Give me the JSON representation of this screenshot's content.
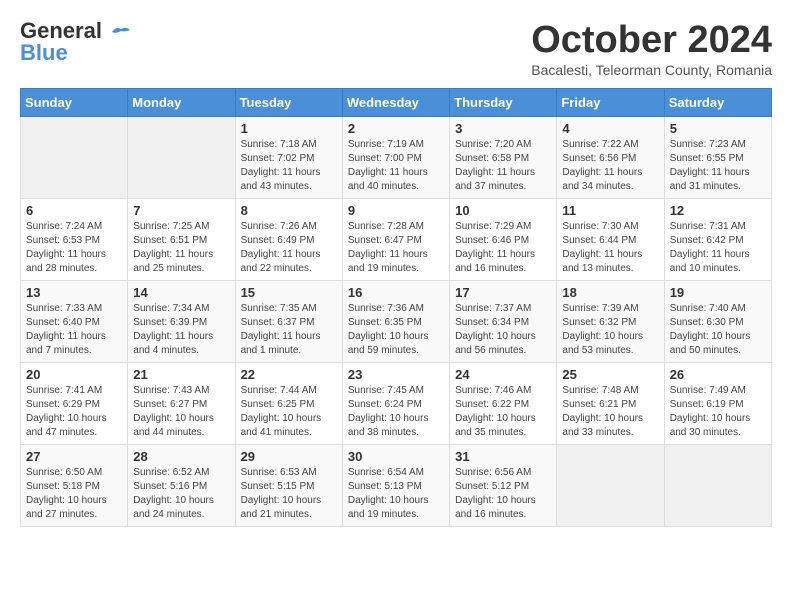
{
  "header": {
    "logo_line1": "General",
    "logo_line2": "Blue",
    "month_title": "October 2024",
    "location": "Bacalesti, Teleorman County, Romania"
  },
  "days_of_week": [
    "Sunday",
    "Monday",
    "Tuesday",
    "Wednesday",
    "Thursday",
    "Friday",
    "Saturday"
  ],
  "weeks": [
    [
      {
        "day": "",
        "info": ""
      },
      {
        "day": "",
        "info": ""
      },
      {
        "day": "1",
        "info": "Sunrise: 7:18 AM\nSunset: 7:02 PM\nDaylight: 11 hours and 43 minutes."
      },
      {
        "day": "2",
        "info": "Sunrise: 7:19 AM\nSunset: 7:00 PM\nDaylight: 11 hours and 40 minutes."
      },
      {
        "day": "3",
        "info": "Sunrise: 7:20 AM\nSunset: 6:58 PM\nDaylight: 11 hours and 37 minutes."
      },
      {
        "day": "4",
        "info": "Sunrise: 7:22 AM\nSunset: 6:56 PM\nDaylight: 11 hours and 34 minutes."
      },
      {
        "day": "5",
        "info": "Sunrise: 7:23 AM\nSunset: 6:55 PM\nDaylight: 11 hours and 31 minutes."
      }
    ],
    [
      {
        "day": "6",
        "info": "Sunrise: 7:24 AM\nSunset: 6:53 PM\nDaylight: 11 hours and 28 minutes."
      },
      {
        "day": "7",
        "info": "Sunrise: 7:25 AM\nSunset: 6:51 PM\nDaylight: 11 hours and 25 minutes."
      },
      {
        "day": "8",
        "info": "Sunrise: 7:26 AM\nSunset: 6:49 PM\nDaylight: 11 hours and 22 minutes."
      },
      {
        "day": "9",
        "info": "Sunrise: 7:28 AM\nSunset: 6:47 PM\nDaylight: 11 hours and 19 minutes."
      },
      {
        "day": "10",
        "info": "Sunrise: 7:29 AM\nSunset: 6:46 PM\nDaylight: 11 hours and 16 minutes."
      },
      {
        "day": "11",
        "info": "Sunrise: 7:30 AM\nSunset: 6:44 PM\nDaylight: 11 hours and 13 minutes."
      },
      {
        "day": "12",
        "info": "Sunrise: 7:31 AM\nSunset: 6:42 PM\nDaylight: 11 hours and 10 minutes."
      }
    ],
    [
      {
        "day": "13",
        "info": "Sunrise: 7:33 AM\nSunset: 6:40 PM\nDaylight: 11 hours and 7 minutes."
      },
      {
        "day": "14",
        "info": "Sunrise: 7:34 AM\nSunset: 6:39 PM\nDaylight: 11 hours and 4 minutes."
      },
      {
        "day": "15",
        "info": "Sunrise: 7:35 AM\nSunset: 6:37 PM\nDaylight: 11 hours and 1 minute."
      },
      {
        "day": "16",
        "info": "Sunrise: 7:36 AM\nSunset: 6:35 PM\nDaylight: 10 hours and 59 minutes."
      },
      {
        "day": "17",
        "info": "Sunrise: 7:37 AM\nSunset: 6:34 PM\nDaylight: 10 hours and 56 minutes."
      },
      {
        "day": "18",
        "info": "Sunrise: 7:39 AM\nSunset: 6:32 PM\nDaylight: 10 hours and 53 minutes."
      },
      {
        "day": "19",
        "info": "Sunrise: 7:40 AM\nSunset: 6:30 PM\nDaylight: 10 hours and 50 minutes."
      }
    ],
    [
      {
        "day": "20",
        "info": "Sunrise: 7:41 AM\nSunset: 6:29 PM\nDaylight: 10 hours and 47 minutes."
      },
      {
        "day": "21",
        "info": "Sunrise: 7:43 AM\nSunset: 6:27 PM\nDaylight: 10 hours and 44 minutes."
      },
      {
        "day": "22",
        "info": "Sunrise: 7:44 AM\nSunset: 6:25 PM\nDaylight: 10 hours and 41 minutes."
      },
      {
        "day": "23",
        "info": "Sunrise: 7:45 AM\nSunset: 6:24 PM\nDaylight: 10 hours and 38 minutes."
      },
      {
        "day": "24",
        "info": "Sunrise: 7:46 AM\nSunset: 6:22 PM\nDaylight: 10 hours and 35 minutes."
      },
      {
        "day": "25",
        "info": "Sunrise: 7:48 AM\nSunset: 6:21 PM\nDaylight: 10 hours and 33 minutes."
      },
      {
        "day": "26",
        "info": "Sunrise: 7:49 AM\nSunset: 6:19 PM\nDaylight: 10 hours and 30 minutes."
      }
    ],
    [
      {
        "day": "27",
        "info": "Sunrise: 6:50 AM\nSunset: 5:18 PM\nDaylight: 10 hours and 27 minutes."
      },
      {
        "day": "28",
        "info": "Sunrise: 6:52 AM\nSunset: 5:16 PM\nDaylight: 10 hours and 24 minutes."
      },
      {
        "day": "29",
        "info": "Sunrise: 6:53 AM\nSunset: 5:15 PM\nDaylight: 10 hours and 21 minutes."
      },
      {
        "day": "30",
        "info": "Sunrise: 6:54 AM\nSunset: 5:13 PM\nDaylight: 10 hours and 19 minutes."
      },
      {
        "day": "31",
        "info": "Sunrise: 6:56 AM\nSunset: 5:12 PM\nDaylight: 10 hours and 16 minutes."
      },
      {
        "day": "",
        "info": ""
      },
      {
        "day": "",
        "info": ""
      }
    ]
  ]
}
